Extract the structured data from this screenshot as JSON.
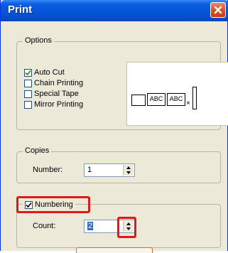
{
  "dialog": {
    "title": "Print"
  },
  "options": {
    "legend": "Options",
    "checkboxes": [
      {
        "label": "Auto Cut",
        "checked": true
      },
      {
        "label": "Chain Printing",
        "checked": false
      },
      {
        "label": "Special Tape",
        "checked": false
      },
      {
        "label": "Mirror Printing",
        "checked": false
      }
    ],
    "preview": {
      "abc1": "ABC",
      "abc2": "ABC",
      "mark": "×"
    }
  },
  "copies": {
    "legend": "Copies",
    "number_label": "Number:",
    "number_value": "1"
  },
  "numbering": {
    "label": "Numbering",
    "checked": true,
    "count_label": "Count:",
    "count_value": "2"
  },
  "colors": {
    "title_bar": "#0554d8",
    "highlight": "#e01818",
    "dialog_bg": "#ece9d8"
  }
}
